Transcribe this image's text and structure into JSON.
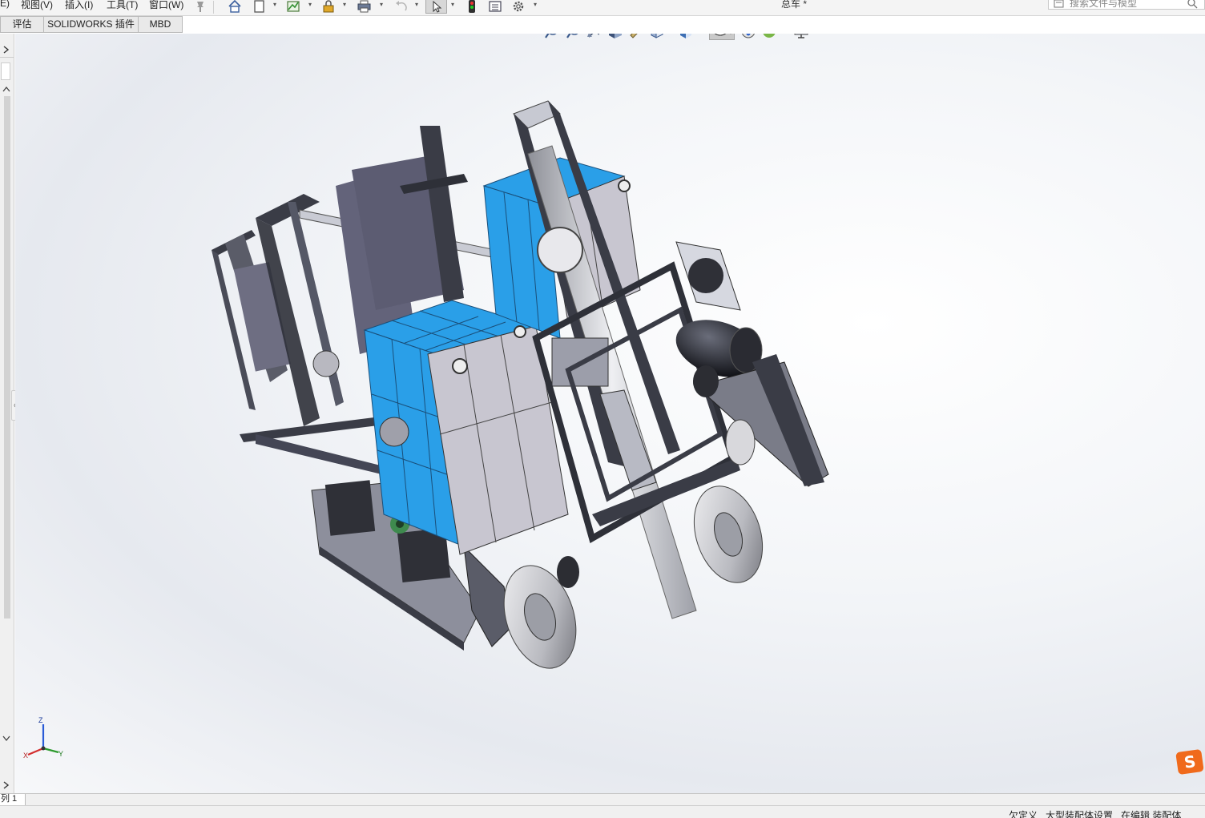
{
  "menu": {
    "items": [
      "E)",
      "视图(V)",
      "插入(I)",
      "工具(T)",
      "窗口(W)"
    ]
  },
  "document": {
    "title": "总车 *"
  },
  "search": {
    "placeholder": "搜索文件与模型"
  },
  "tabs": [
    "评估",
    "SOLIDWORKS 插件",
    "MBD"
  ],
  "bottom_tab": {
    "label": "列 1"
  },
  "status": {
    "items": [
      "欠定义",
      "大型装配体设置",
      "在编辑 装配体"
    ]
  },
  "triad": {
    "x": "X",
    "y": "Y",
    "z": "Z"
  },
  "colors": {
    "accent_blue": "#2a9fe8",
    "frame_dark": "#3a3c46",
    "panel_grey": "#c7c9d2",
    "sogou_orange": "#f06a1c"
  },
  "icons": {
    "toolbar": [
      "home-icon",
      "new-document-icon",
      "rebuild-icon",
      "lock-icon",
      "print-icon",
      "undo-icon",
      "select-pointer-icon",
      "traffic-light-icon",
      "options-list-icon",
      "settings-gear-icon",
      "pin-icon"
    ],
    "heads_up": [
      "zoom-to-fit-icon",
      "zoom-to-area-icon",
      "previous-view-icon",
      "section-view-icon",
      "dynamic-annotation-icon",
      "view-orientation-icon",
      "display-style-icon",
      "hide-show-items-icon",
      "edit-appearance-icon",
      "apply-scene-icon",
      "view-settings-icon"
    ]
  }
}
